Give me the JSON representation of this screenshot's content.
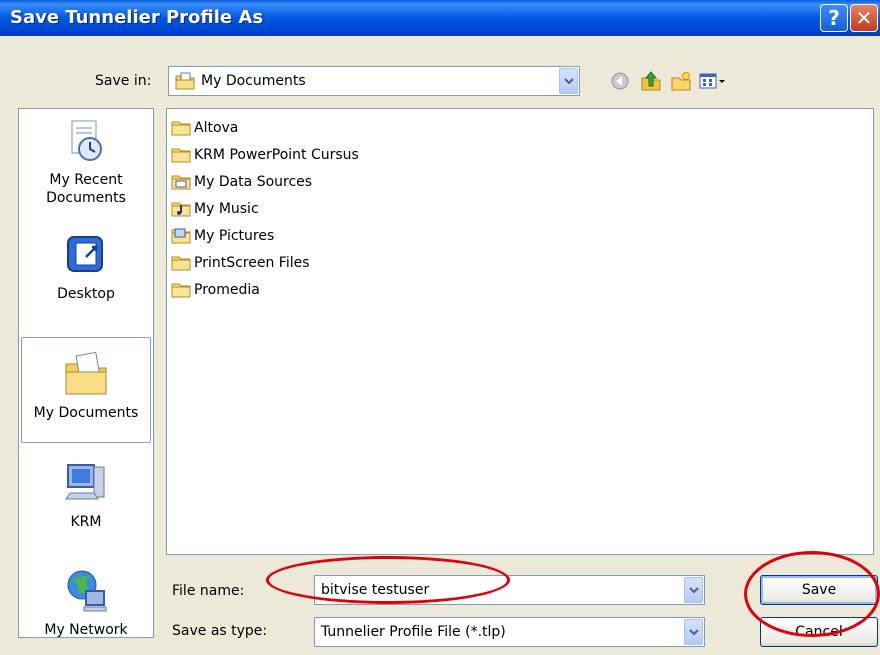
{
  "window": {
    "title": "Save Tunnelier Profile As",
    "help_glyph": "?",
    "close_glyph": "✕"
  },
  "save_in": {
    "label": "Save in:",
    "value": "My Documents"
  },
  "toolbar": {
    "back_icon": "back-icon",
    "up_icon": "up-folder-icon",
    "new_folder_icon": "new-folder-icon",
    "views_icon": "views-menu-icon"
  },
  "places": [
    {
      "label": "My Recent\nDocuments",
      "icon": "recent-documents-icon"
    },
    {
      "label": "Desktop",
      "icon": "desktop-icon"
    },
    {
      "label": "My Documents",
      "icon": "my-documents-icon",
      "active": true
    },
    {
      "label": "KRM",
      "icon": "computer-icon"
    },
    {
      "label": "My Network",
      "icon": "network-icon"
    }
  ],
  "files": [
    {
      "name": "Altova",
      "icon": "folder-icon"
    },
    {
      "name": "KRM PowerPoint Cursus",
      "icon": "folder-icon"
    },
    {
      "name": "My Data Sources",
      "icon": "data-sources-folder-icon"
    },
    {
      "name": "My Music",
      "icon": "music-folder-icon"
    },
    {
      "name": "My Pictures",
      "icon": "pictures-folder-icon"
    },
    {
      "name": "PrintScreen Files",
      "icon": "folder-icon"
    },
    {
      "name": "Promedia",
      "icon": "folder-icon"
    }
  ],
  "file_name": {
    "label": "File name:",
    "value": "bitvise testuser"
  },
  "save_as_type": {
    "label": "Save as type:",
    "value": "Tunnelier Profile File (*.tlp)"
  },
  "buttons": {
    "save": "Save",
    "cancel": "Cancel"
  },
  "annotation_color": "#E0000A"
}
